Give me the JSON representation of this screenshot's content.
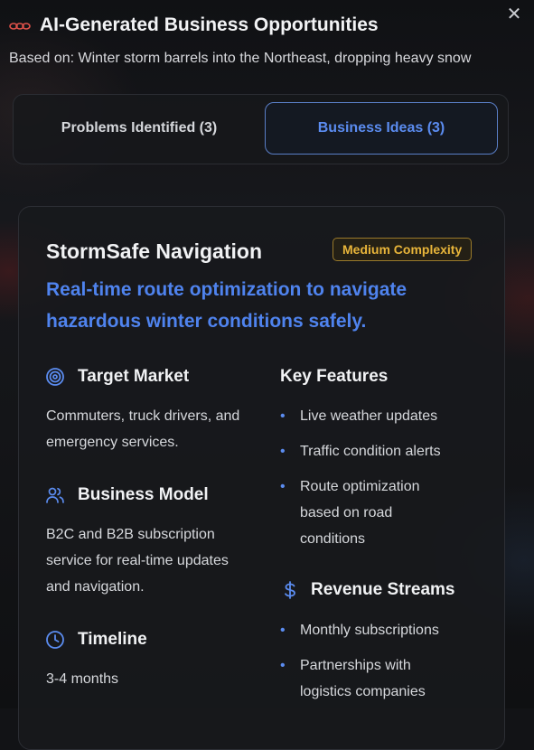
{
  "header": {
    "title": "AI-Generated Business Opportunities",
    "subtitle": "Based on: Winter storm barrels into the Northeast, dropping heavy snow",
    "close_icon": "close-icon",
    "logo_icon": "link-chain-icon"
  },
  "tabs": [
    {
      "label": "Problems Identified (3)",
      "active": false
    },
    {
      "label": "Business Ideas (3)",
      "active": true
    }
  ],
  "idea": {
    "name": "StormSafe Navigation",
    "complexity": "Medium Complexity",
    "tagline": "Real-time route optimization to navigate hazardous winter conditions safely.",
    "target_market": {
      "heading": "Target Market",
      "icon": "target-icon",
      "text": "Commuters, truck drivers, and emergency services."
    },
    "business_model": {
      "heading": "Business Model",
      "icon": "users-icon",
      "text": "B2C and B2B subscription service for real-time updates and navigation."
    },
    "timeline": {
      "heading": "Timeline",
      "icon": "clock-icon",
      "text": "3-4 months"
    },
    "key_features": {
      "heading": "Key Features",
      "items": [
        "Live weather updates",
        "Traffic condition alerts",
        "Route optimization based on road conditions"
      ]
    },
    "revenue_streams": {
      "heading": "Revenue Streams",
      "icon": "dollar-icon",
      "items": [
        "Monthly subscriptions",
        "Partnerships with logistics companies"
      ]
    }
  },
  "colors": {
    "accent": "#5b8cf0",
    "badge": "#e8b53a",
    "logo": "#e0524a"
  }
}
